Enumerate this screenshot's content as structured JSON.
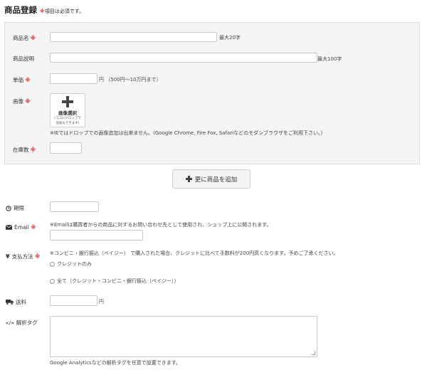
{
  "header": {
    "title": "商品登録",
    "required_mark": "※",
    "required_note": "項目は必須です。"
  },
  "product": {
    "name": {
      "label": "商品名",
      "mark": "※",
      "hint": "最大20字",
      "value": ""
    },
    "description": {
      "label": "商品説明",
      "hint": "最大100字",
      "value": ""
    },
    "price": {
      "label": "単価",
      "mark": "※",
      "unit": "円",
      "hint": "（500円〜10万円まで）",
      "value": ""
    },
    "image": {
      "label": "画像",
      "mark": "※",
      "button_label": "画像選択",
      "button_sub_1": "(ココにドロップで",
      "button_sub_2": "追加もできます)",
      "note": "※IEではドロップでの画像追加は出来ません。(Google Chrome, Fire Fox, Safariなどのモダンブラウザをご利用下さい。)"
    },
    "stock": {
      "label": "在庫数",
      "mark": "※",
      "value": ""
    }
  },
  "add_button": {
    "label": "更に商品を追加"
  },
  "period": {
    "label": "期限",
    "value": ""
  },
  "email": {
    "label": "Email",
    "mark": "※",
    "note": "※Emailは購買者からの商品に対するお問い合わせ先として使用され、ショップ上に公開されます。",
    "value": ""
  },
  "payment": {
    "label": "支払方法",
    "mark": "※",
    "note": "※コンビニ・銀行振込（ペイジー） で購入された場合、クレジットに比べて手数料が200円高くなります。予めご了承ください。",
    "options": [
      "クレジットのみ",
      "全て（クレジット・コンビニ・銀行振込（ペイジー））"
    ]
  },
  "shipping": {
    "label": "送料",
    "unit": "円",
    "value": ""
  },
  "analytics": {
    "label": "解析タグ",
    "note": "Google Analyticsなどの解析タグを任意で設置できます。",
    "value": ""
  }
}
